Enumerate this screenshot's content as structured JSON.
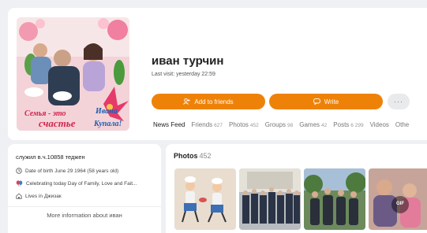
{
  "profile": {
    "name": "иван турчин",
    "last_visit": "Last visit: yesterday 22:59",
    "avatar_text": {
      "line1": "Семья - это",
      "line2": "счастье",
      "line3": "Ивана",
      "line4": "Купала!"
    }
  },
  "actions": {
    "add_friends": "Add to friends",
    "write": "Write",
    "more": "···"
  },
  "tabs": [
    {
      "label": "News Feed",
      "count": ""
    },
    {
      "label": "Friends",
      "count": "627"
    },
    {
      "label": "Photos",
      "count": "452"
    },
    {
      "label": "Groups",
      "count": "98"
    },
    {
      "label": "Games",
      "count": "42"
    },
    {
      "label": "Posts",
      "count": "6 299"
    },
    {
      "label": "Videos",
      "count": ""
    },
    {
      "label": "Othe",
      "count": ""
    }
  ],
  "info": {
    "about": "служил в.ч.10858 теджен",
    "birth": "Date of birth June 29 1964 (58 years old)",
    "celebrating": "Celebrating today Day of Family, Love and Fait...",
    "lives": "Lives in Джизак",
    "more_info": "More information about иван"
  },
  "photos": {
    "title": "Photos",
    "count": "452",
    "gif_badge": "GIF"
  },
  "colors": {
    "accent": "#ee8208",
    "background": "#eef0f3",
    "card": "#ffffff"
  }
}
